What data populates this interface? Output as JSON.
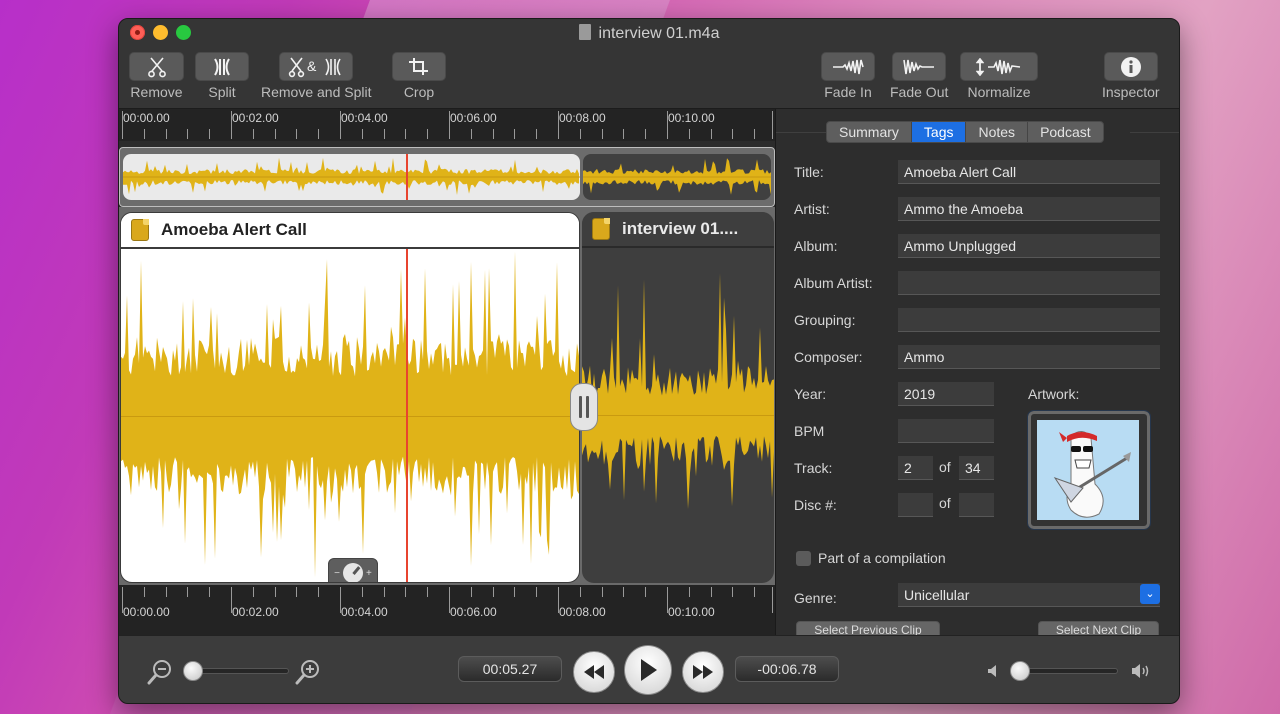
{
  "window": {
    "title": "interview 01.m4a",
    "title_icon": "document-icon"
  },
  "toolbar": {
    "left": [
      {
        "id": "remove",
        "label": "Remove",
        "icon": "scissors-icon",
        "glyph": "✂"
      },
      {
        "id": "split",
        "label": "Split",
        "icon": "split-icon",
        "glyph": ")("
      },
      {
        "id": "remove-and-split",
        "label": "Remove and Split",
        "icon": "remove-and-split-icon",
        "glyph": "✂&)("
      },
      {
        "id": "crop",
        "label": "Crop",
        "icon": "crop-icon",
        "glyph": "⌗"
      }
    ],
    "right": [
      {
        "id": "fade-in",
        "label": "Fade In",
        "icon": "fade-in-icon"
      },
      {
        "id": "fade-out",
        "label": "Fade Out",
        "icon": "fade-out-icon"
      },
      {
        "id": "normalize",
        "label": "Normalize",
        "icon": "normalize-icon"
      },
      {
        "id": "inspector",
        "label": "Inspector",
        "icon": "info-icon",
        "glyph": "i"
      }
    ]
  },
  "timeline": {
    "tick_labels": [
      "00:00.00",
      "00:02.00",
      "00:04.00",
      "00:06.00",
      "00:08.00",
      "00:10.00"
    ],
    "playhead_time": "00:04.71",
    "accent_color": "#e0b318",
    "playhead_color": "#e8442f"
  },
  "clips": [
    {
      "name": "Amoeba Alert Call",
      "icon": "aac-file-icon",
      "selected": true
    },
    {
      "name": "interview 01....",
      "icon": "aac-file-icon",
      "selected": false
    }
  ],
  "transport": {
    "elapsed": "00:05.27",
    "remaining": "-00:06.78",
    "zoom_level": 0.0,
    "volume_level": 0.0
  },
  "inspector": {
    "tabs": [
      {
        "label": "Summary",
        "active": false
      },
      {
        "label": "Tags",
        "active": true
      },
      {
        "label": "Notes",
        "active": false
      },
      {
        "label": "Podcast",
        "active": false
      }
    ],
    "fields": {
      "title": {
        "label": "Title:",
        "value": "Amoeba Alert Call"
      },
      "artist": {
        "label": "Artist:",
        "value": "Ammo the Amoeba"
      },
      "album": {
        "label": "Album:",
        "value": "Ammo Unplugged"
      },
      "album_artist": {
        "label": "Album Artist:",
        "value": ""
      },
      "grouping": {
        "label": "Grouping:",
        "value": ""
      },
      "composer": {
        "label": "Composer:",
        "value": "Ammo"
      },
      "year": {
        "label": "Year:",
        "value": "2019"
      },
      "bpm": {
        "label": "BPM",
        "value": ""
      },
      "track": {
        "label": "Track:",
        "value": "2",
        "of": "34"
      },
      "disc": {
        "label": "Disc #:",
        "value": "",
        "of": ""
      },
      "genre": {
        "label": "Genre:",
        "value": "Unicellular"
      }
    },
    "of_label": "of",
    "artwork_label": "Artwork:",
    "compilation_label": "Part of a compilation",
    "compilation_checked": false,
    "prev_clip_label": "Select Previous Clip",
    "next_clip_label": "Select Next Clip"
  }
}
